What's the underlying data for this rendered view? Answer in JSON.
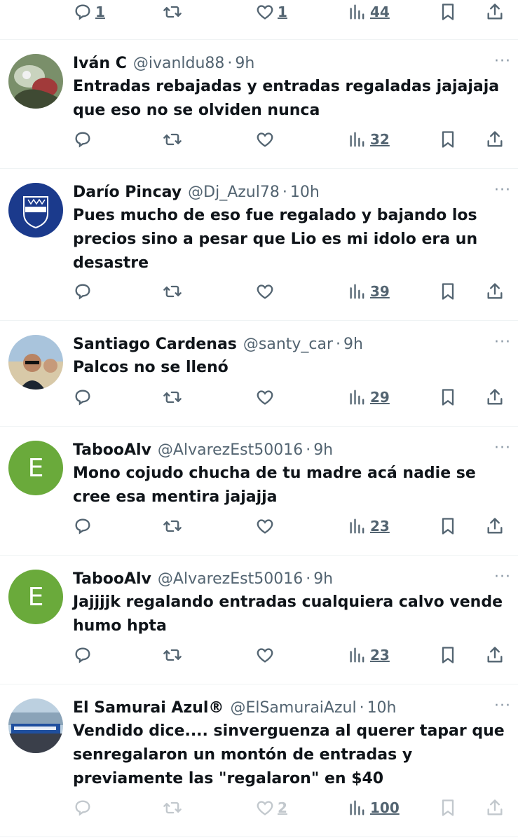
{
  "partial": {
    "reply_count": "1",
    "like_count": "1",
    "views": "44"
  },
  "tweets": [
    {
      "name": "Iván C",
      "handle": "@ivanldu88",
      "sep": "·",
      "time": "9h",
      "text": "Entradas rebajadas y entradas regaladas jajajaja que eso no se olviden nunca",
      "views": "32",
      "like_count": "",
      "more": "···"
    },
    {
      "name": "Darío Pincay",
      "handle": "@Dj_Azul78",
      "sep": "·",
      "time": "10h",
      "text": "Pues mucho de eso fue regalado y bajando los precios sino a pesar que Lio es mi idolo era un desastre",
      "views": "39",
      "like_count": "",
      "more": "···"
    },
    {
      "name": "Santiago Cardenas",
      "handle": "@santy_car",
      "sep": "·",
      "time": "9h",
      "text": "Palcos no se llenó",
      "views": "29",
      "like_count": "",
      "more": "···"
    },
    {
      "name": "TabooAlv",
      "handle": "@AlvarezEst50016",
      "sep": "·",
      "time": "9h",
      "avatar_letter": "E",
      "text": "Mono cojudo chucha de tu madre acá nadie se cree esa mentira jajajja",
      "views": "23",
      "like_count": "",
      "more": "···"
    },
    {
      "name": "TabooAlv",
      "handle": "@AlvarezEst50016",
      "sep": "·",
      "time": "9h",
      "avatar_letter": "E",
      "text": "Jajjjjk regalando entradas cualquiera calvo vende humo hpta",
      "views": "23",
      "like_count": "",
      "more": "···"
    },
    {
      "name": "El Samurai Azul®",
      "handle": "@ElSamuraiAzul",
      "sep": "·",
      "time": "10h",
      "text": "Vendido dice.... sinverguenza al querer tapar que senregalaron un montón de entradas y previamente las \"regalaron\" en $40",
      "views": "100",
      "like_count": "2",
      "more": "···"
    }
  ],
  "colors": {
    "text": "#0f1419",
    "secondary": "#536471",
    "divider": "#eff3f4",
    "letter_avatar": "#6aaa3b",
    "emelec_blue": "#1b3a8c"
  },
  "icons": [
    "reply-icon",
    "retweet-icon",
    "like-icon",
    "views-icon",
    "bookmark-icon",
    "share-icon",
    "more-icon"
  ]
}
